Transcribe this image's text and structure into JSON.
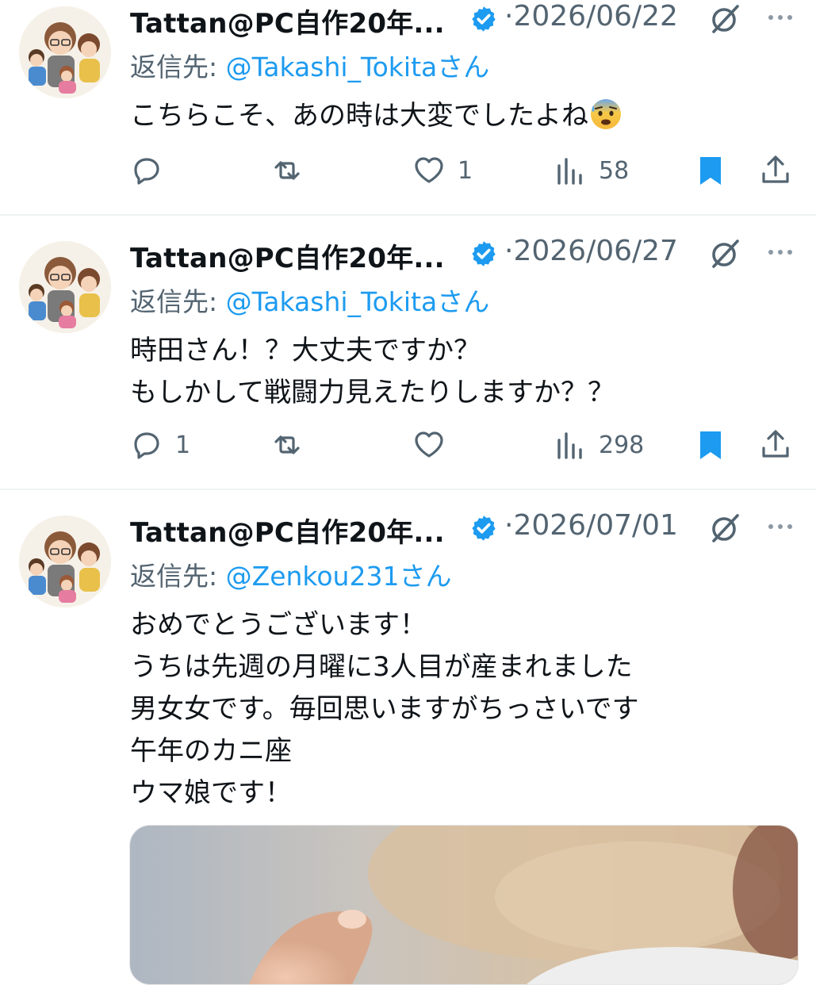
{
  "tweets": [
    {
      "author_name": "Tattan@PC自作20年...",
      "date": "2026/06/22",
      "reply_prefix": "返信先: ",
      "reply_handle": "@Takashi_Tokitaさん",
      "lines": [
        "こちらこそ、あの時は大変でしたよね"
      ],
      "emoji": "anxious-face-with-sweat",
      "replies": "",
      "likes": "1",
      "views": "58"
    },
    {
      "author_name": "Tattan@PC自作20年...",
      "date": "2026/06/27",
      "reply_prefix": "返信先: ",
      "reply_handle": "@Takashi_Tokitaさん",
      "lines": [
        "時田さん！？大丈夫ですか？",
        "もしかして戦闘力見えたりしますか？？"
      ],
      "replies": "1",
      "likes": "",
      "views": "298"
    },
    {
      "author_name": "Tattan@PC自作20年...",
      "date": "2026/07/01",
      "reply_prefix": "返信先: ",
      "reply_handle": "@Zenkou231さん",
      "lines": [
        "おめでとうございます！",
        "うちは先週の月曜に3人目が産まれました",
        "男女女です。毎回思いますがちっさいです",
        "午年のカニ座",
        "ウマ娘です！"
      ]
    }
  ],
  "date_separator": "·",
  "colors": {
    "accent": "#1d9bf0",
    "muted": "#536471",
    "text": "#0f1419"
  }
}
